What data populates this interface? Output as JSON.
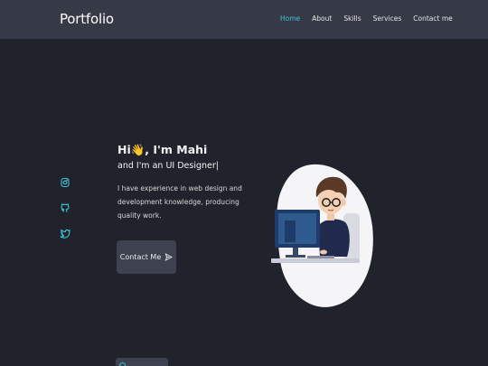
{
  "nav": {
    "logo": "Portfolio",
    "links": [
      "Home",
      "About",
      "Skills",
      "Services",
      "Contact me"
    ],
    "active": "Home",
    "accent": "#3cc6d6"
  },
  "socials": [
    {
      "icon": "instagram-icon"
    },
    {
      "icon": "github-icon"
    },
    {
      "icon": "twitter-icon"
    }
  ],
  "hero": {
    "greeting": "Hi👋, I'm Mahi",
    "role": "and I'm an UI Designer|",
    "description": "I have experience in web design and development knowledge, producing quality work.",
    "button_label": "Contact Me",
    "button_icon": "send-icon"
  },
  "colors": {
    "background": "#21232c",
    "navbar": "#363a47",
    "button": "#3d4150",
    "accent": "#3cc6d6"
  }
}
